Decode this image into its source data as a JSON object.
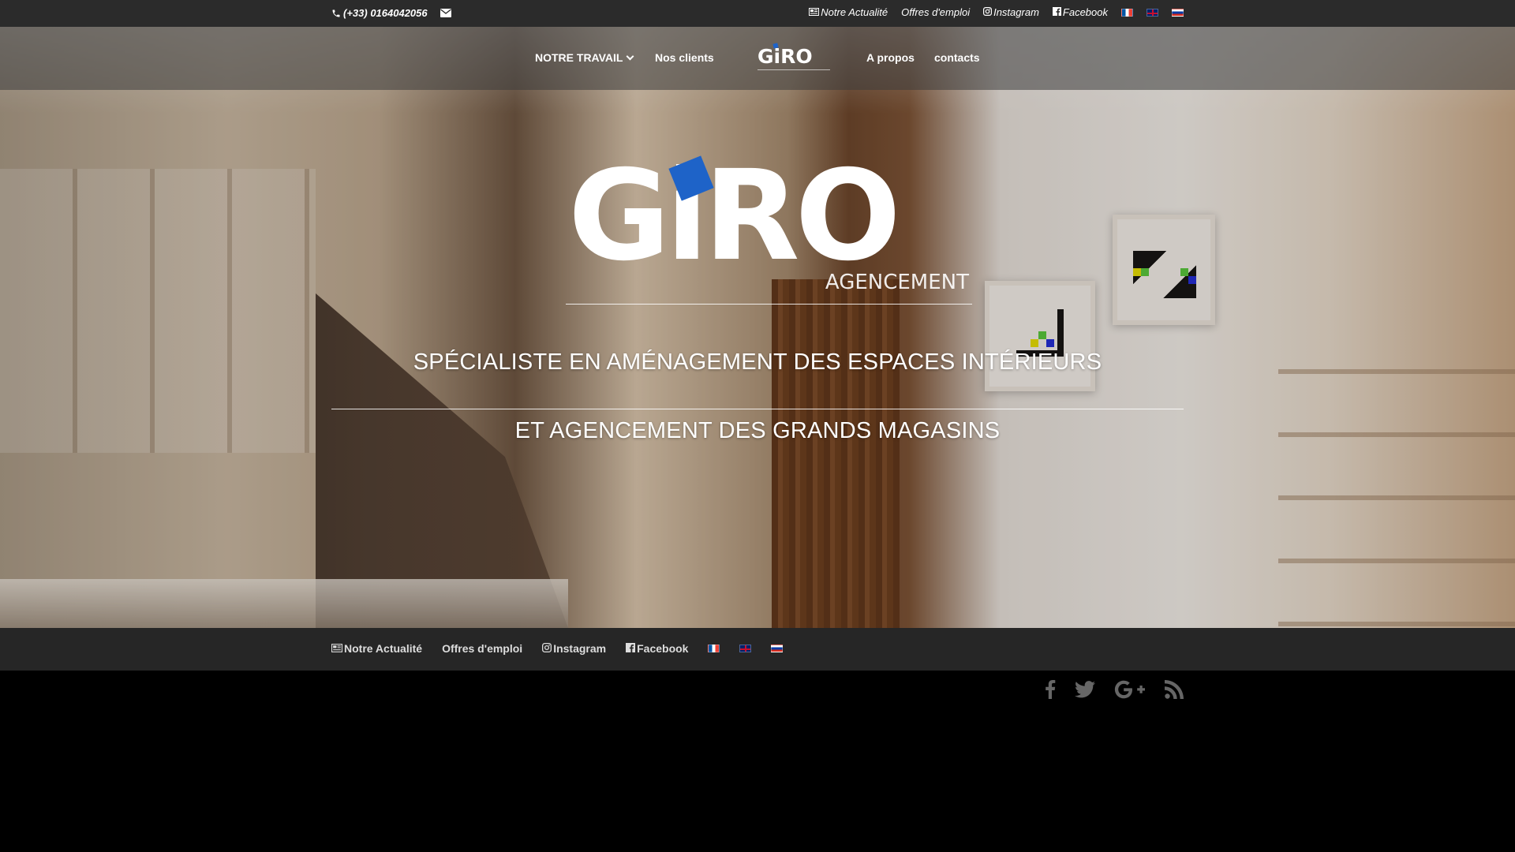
{
  "topbar": {
    "phone": "(+33) 0164042056",
    "links": [
      {
        "label": "Notre Actualité",
        "icon": "newspaper-icon"
      },
      {
        "label": "Offres d'emploi"
      },
      {
        "label": "Instagram",
        "icon": "instagram-icon"
      },
      {
        "label": "Facebook",
        "icon": "facebook-icon"
      }
    ],
    "flags": [
      "fr",
      "en",
      "ru"
    ]
  },
  "nav": {
    "items": [
      "NOTRE TRAVAIL",
      "Nos clients",
      "A propos",
      "contacts"
    ],
    "logo_text": "GiRO"
  },
  "hero": {
    "logo_text": "GiRO",
    "logo_subtitle": "AGENCEMENT",
    "tagline_line1": "SPÉCIALISTE EN AMÉNAGEMENT DES ESPACES INTÉRIEURS",
    "tagline_line2": "ET AGENCEMENT DES GRANDS MAGASINS"
  },
  "footer_nav": {
    "links": [
      {
        "label": "Notre Actualité",
        "icon": "newspaper-icon"
      },
      {
        "label": "Offres d'emploi"
      },
      {
        "label": "Instagram",
        "icon": "instagram-icon"
      },
      {
        "label": "Facebook",
        "icon": "facebook-icon"
      }
    ],
    "flags": [
      "fr",
      "en",
      "ru"
    ]
  },
  "social": [
    "facebook-icon",
    "twitter-icon",
    "google-plus-icon",
    "rss-icon"
  ],
  "colors": {
    "topbar_bg": "#2b2b2b",
    "footer_nav_bg": "#262626",
    "bottom_bg": "#000000",
    "logo_accent": "#1e63c8",
    "social_icon": "#666666"
  }
}
